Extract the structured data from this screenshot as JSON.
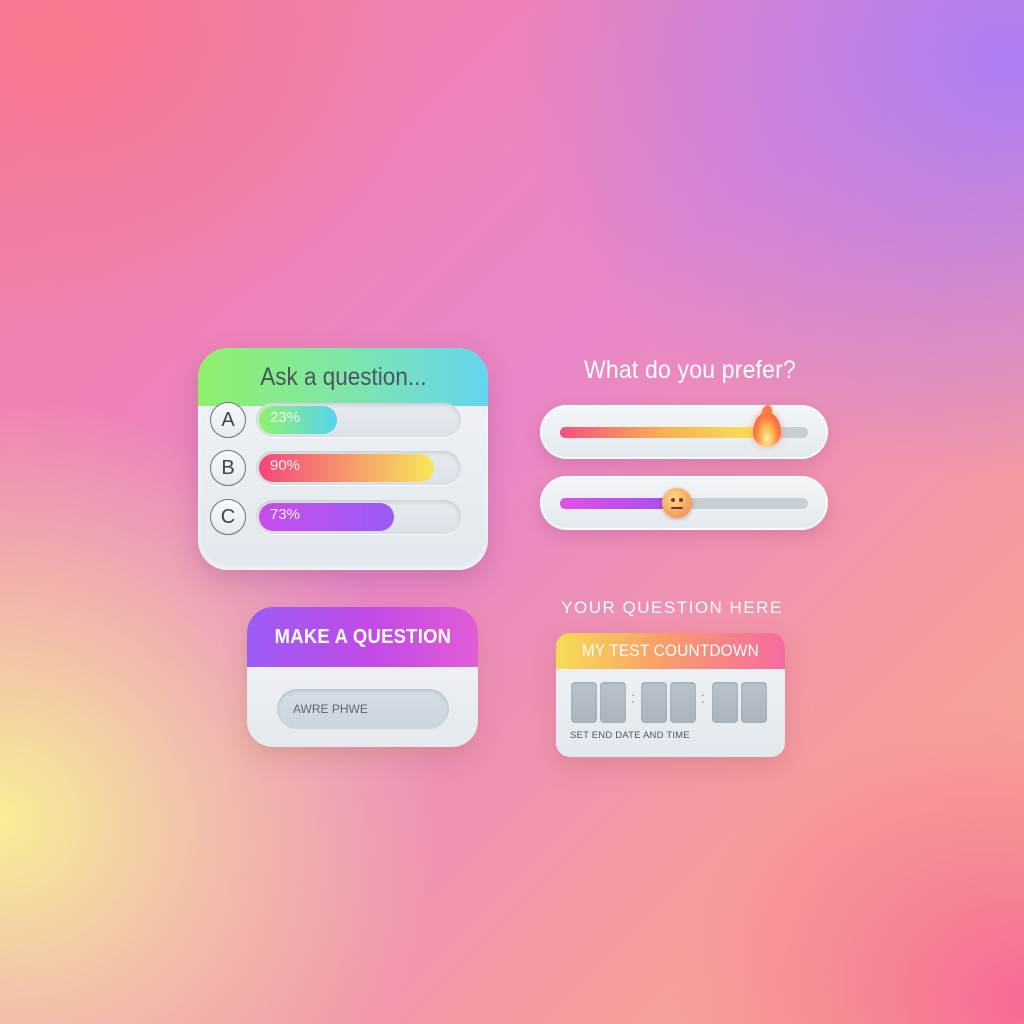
{
  "quiz": {
    "title": "Ask a question...",
    "options": [
      {
        "letter": "A",
        "percent_label": "23%",
        "fill_fraction": 0.39,
        "colors": [
          "#8ff36a",
          "#55d3ef"
        ]
      },
      {
        "letter": "B",
        "percent_label": "90%",
        "fill_fraction": 0.88,
        "colors": [
          "#f5457c",
          "#f6e85a"
        ]
      },
      {
        "letter": "C",
        "percent_label": "73%",
        "fill_fraction": 0.68,
        "colors": [
          "#c84cec",
          "#9a5cf4"
        ]
      }
    ]
  },
  "slider": {
    "question": "What do you prefer?",
    "items": [
      {
        "level": 0.84,
        "emoji": "flame-icon",
        "colors": [
          "#f6507e",
          "#f7b054",
          "#f6e85a"
        ]
      },
      {
        "level": 0.47,
        "emoji": "neutral-face-icon",
        "colors": [
          "#e44ee8",
          "#a24ff0"
        ]
      }
    ]
  },
  "ask": {
    "title": "MAKE A QUESTION",
    "input_placeholder": "AWRE PHWE"
  },
  "countdown": {
    "caption": "YOUR QUESTION HERE",
    "title": "MY TEST COUNTDOWN",
    "digit_slots": 6,
    "hint": "SET END DATE AND TIME"
  }
}
